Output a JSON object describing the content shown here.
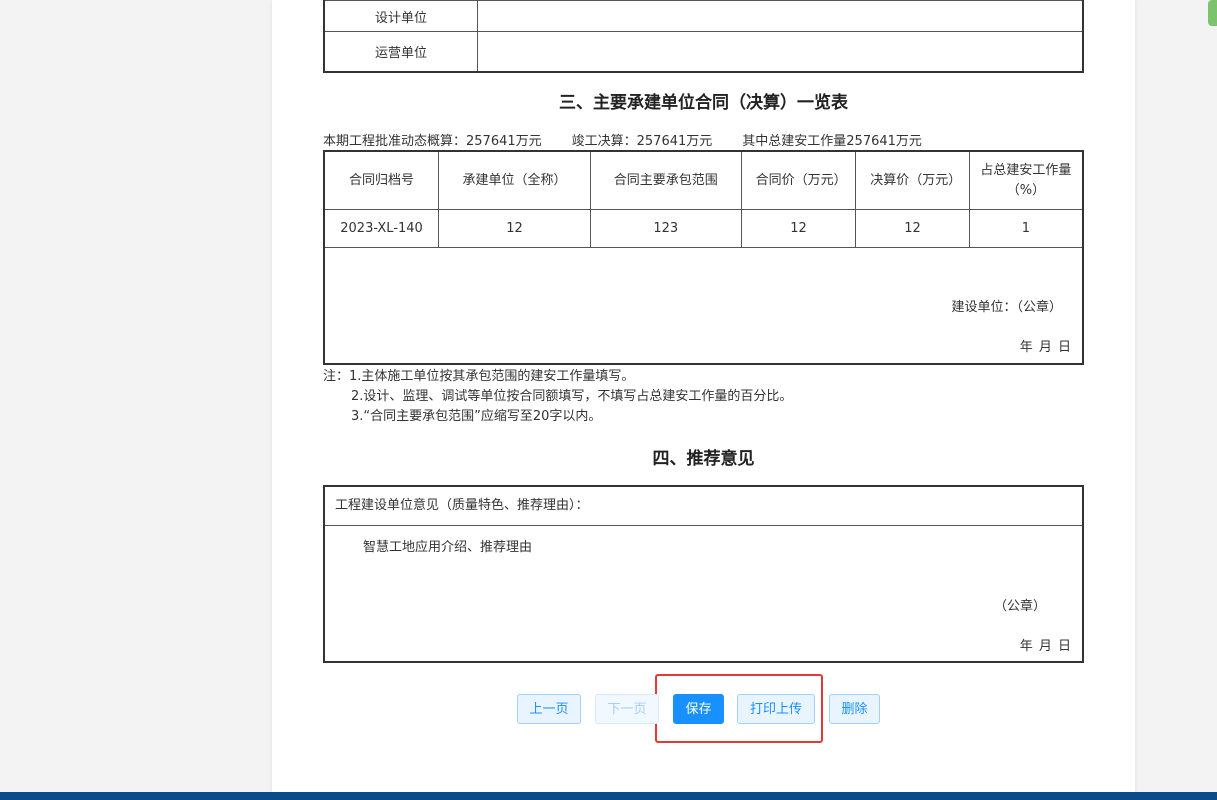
{
  "units_table": {
    "rows": [
      {
        "label": "设计单位",
        "value": ""
      },
      {
        "label": "运营单位",
        "value": ""
      }
    ]
  },
  "section3": {
    "title": "三、主要承建单位合同（决算）一览表",
    "summary": {
      "approved": "本期工程批准动态概算：257641万元",
      "final": "竣工决算：257641万元",
      "total": "其中总建安工作量257641万元"
    },
    "headers": [
      "合同归档号",
      "承建单位（全称）",
      "合同主要承包范围",
      "合同价（万元）",
      "决算价（万元）",
      "占总建安工作量（%）"
    ],
    "rows": [
      [
        "2023-XL-140",
        "12",
        "123",
        "12",
        "12",
        "1"
      ]
    ],
    "seal_label": "建设单位：（公章）",
    "date_label": "年 月 日"
  },
  "notes": {
    "line1": "注：1.主体施工单位按其承包范围的建安工作量填写。",
    "line2": "2.设计、监理、调试等单位按合同额填写，不填写占总建安工作量的百分比。",
    "line3": "3.“合同主要承包范围”应缩写至20字以内。"
  },
  "section4": {
    "title": "四、推荐意见",
    "box_header": "工程建设单位意见（质量特色、推荐理由）：",
    "box_text": "智慧工地应用介绍、推荐理由",
    "seal_label": "（公章）",
    "date_label": "年 月 日"
  },
  "buttons": {
    "prev": "上一页",
    "next": "下一页",
    "save": "保存",
    "print_upload": "打印上传",
    "delete": "删除"
  },
  "colors": {
    "primary": "#1890ff",
    "highlight": "#e53935",
    "bottom_bar": "#0b4a8b",
    "edge_tab": "#7cc36b"
  }
}
